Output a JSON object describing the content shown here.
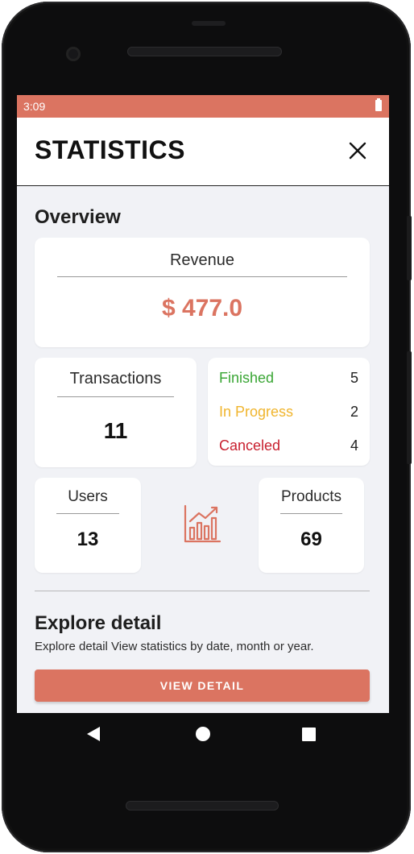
{
  "status_bar": {
    "time": "3:09",
    "battery_icon": "battery-icon"
  },
  "header": {
    "title": "STATISTICS",
    "close_icon": "close-icon"
  },
  "overview": {
    "title": "Overview",
    "revenue": {
      "label": "Revenue",
      "value": "$ 477.0"
    },
    "transactions": {
      "label": "Transactions",
      "value": "11",
      "statuses": [
        {
          "label": "Finished",
          "count": "5",
          "color": "#3aa635"
        },
        {
          "label": "In Progress",
          "count": "2",
          "color": "#f0b52e"
        },
        {
          "label": "Canceled",
          "count": "4",
          "color": "#c8202f"
        }
      ]
    },
    "users": {
      "label": "Users",
      "value": "13"
    },
    "products": {
      "label": "Products",
      "value": "69"
    },
    "chart_icon": "bar-chart-trend-icon"
  },
  "explore": {
    "title": "Explore detail",
    "subtitle": "Explore detail View statistics by date, month or year.",
    "button_label": "VIEW DETAIL"
  },
  "colors": {
    "accent": "#db7461",
    "background": "#f1f2f6"
  }
}
